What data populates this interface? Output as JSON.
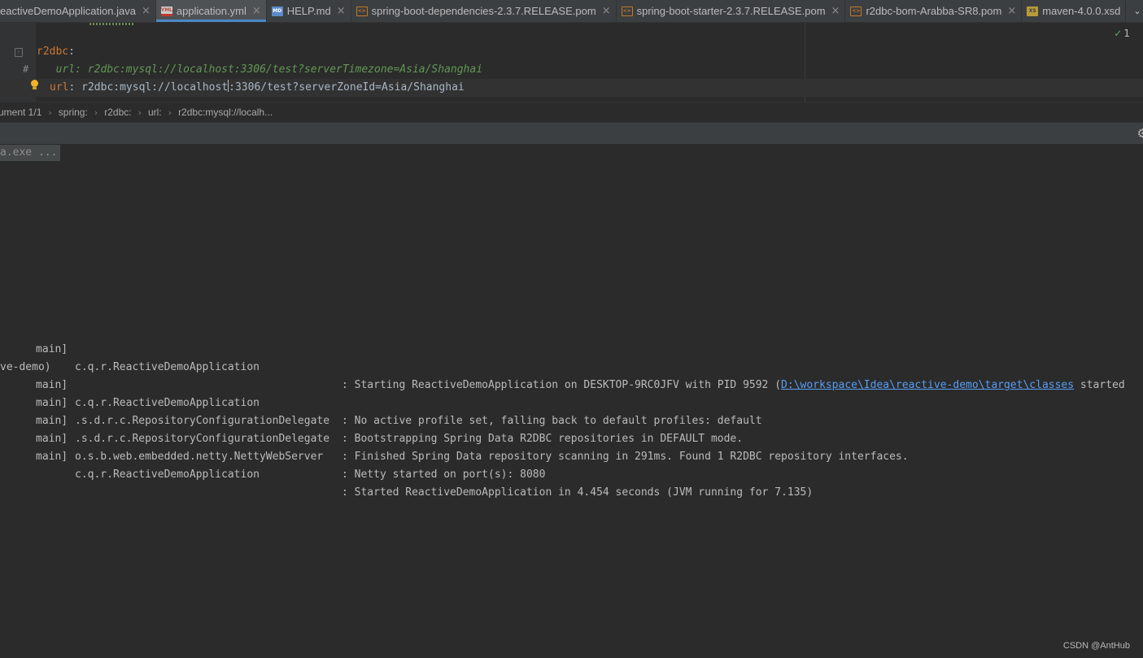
{
  "tabs": [
    {
      "label": "eactiveDemoApplication.java",
      "icon": "",
      "active": false
    },
    {
      "label": "application.yml",
      "icon": "yml-file-icon",
      "badge": "YML",
      "active": true
    },
    {
      "label": "HELP.md",
      "icon": "markdown-file-icon",
      "badge": "MD",
      "active": false
    },
    {
      "label": "spring-boot-dependencies-2.3.7.RELEASE.pom",
      "icon": "pom-file-icon",
      "badge": "<>",
      "active": false
    },
    {
      "label": "spring-boot-starter-2.3.7.RELEASE.pom",
      "icon": "pom-file-icon",
      "badge": "<>",
      "active": false
    },
    {
      "label": "r2dbc-bom-Arabba-SR8.pom",
      "icon": "pom-file-icon",
      "badge": "<>",
      "active": false
    },
    {
      "label": "maven-4.0.0.xsd",
      "icon": "xsd-file-icon",
      "badge": "XS",
      "active": false
    }
  ],
  "tab_close_glyph": "×",
  "tab_overflow_glyph": "⌄",
  "editor": {
    "inspection_count": "1",
    "inspection_glyph": "✓",
    "comment_marker": "#",
    "lines": {
      "key": "r2dbc",
      "key_colon": ":",
      "commented": "  url: r2dbc:mysql://localhost:3306/test?serverTimezone=Asia/Shanghai",
      "current_key": "url",
      "current_sep": ": ",
      "current_value_before_caret": "r2dbc:mysql://localhost",
      "current_value_after_caret": ":3306/test?serverZoneId=Asia/Shanghai"
    }
  },
  "breadcrumb": [
    "ument 1/1",
    "spring:",
    "r2dbc:",
    "url:",
    "r2dbc:mysql://localh..."
  ],
  "breadcrumb_separator": "›",
  "console": {
    "command": "a.exe ...",
    "logs": [
      {
        "thread": "main]",
        "logger": "c.q.r.ReactiveDemoApplication",
        "msg_prefix": ": Starting ReactiveDemoApplication on DESKTOP-9RC0JFV with PID 9592 (",
        "link": "D:\\workspace\\Idea\\reactive-demo\\target\\classes",
        "msg_suffix": " started"
      },
      {
        "continuation": "ve-demo)"
      },
      {
        "thread": "main]",
        "logger": "c.q.r.ReactiveDemoApplication",
        "msg": ": No active profile set, falling back to default profiles: default"
      },
      {
        "thread": "main]",
        "logger": ".s.d.r.c.RepositoryConfigurationDelegate",
        "msg": ": Bootstrapping Spring Data R2DBC repositories in DEFAULT mode."
      },
      {
        "thread": "main]",
        "logger": ".s.d.r.c.RepositoryConfigurationDelegate",
        "msg": ": Finished Spring Data repository scanning in 291ms. Found 1 R2DBC repository interfaces."
      },
      {
        "thread": "main]",
        "logger": "o.s.b.web.embedded.netty.NettyWebServer",
        "msg": ": Netty started on port(s): 8080"
      },
      {
        "thread": "main]",
        "logger": "c.q.r.ReactiveDemoApplication",
        "msg": ": Started ReactiveDemoApplication in 4.454 seconds (JVM running for 7.135)"
      }
    ]
  },
  "watermark": "CSDN @AntHub",
  "colors": {
    "accent": "#4a88c7",
    "yaml_key": "#cc7832",
    "comment": "#629755",
    "link": "#589df6",
    "background": "#2b2b2b"
  }
}
